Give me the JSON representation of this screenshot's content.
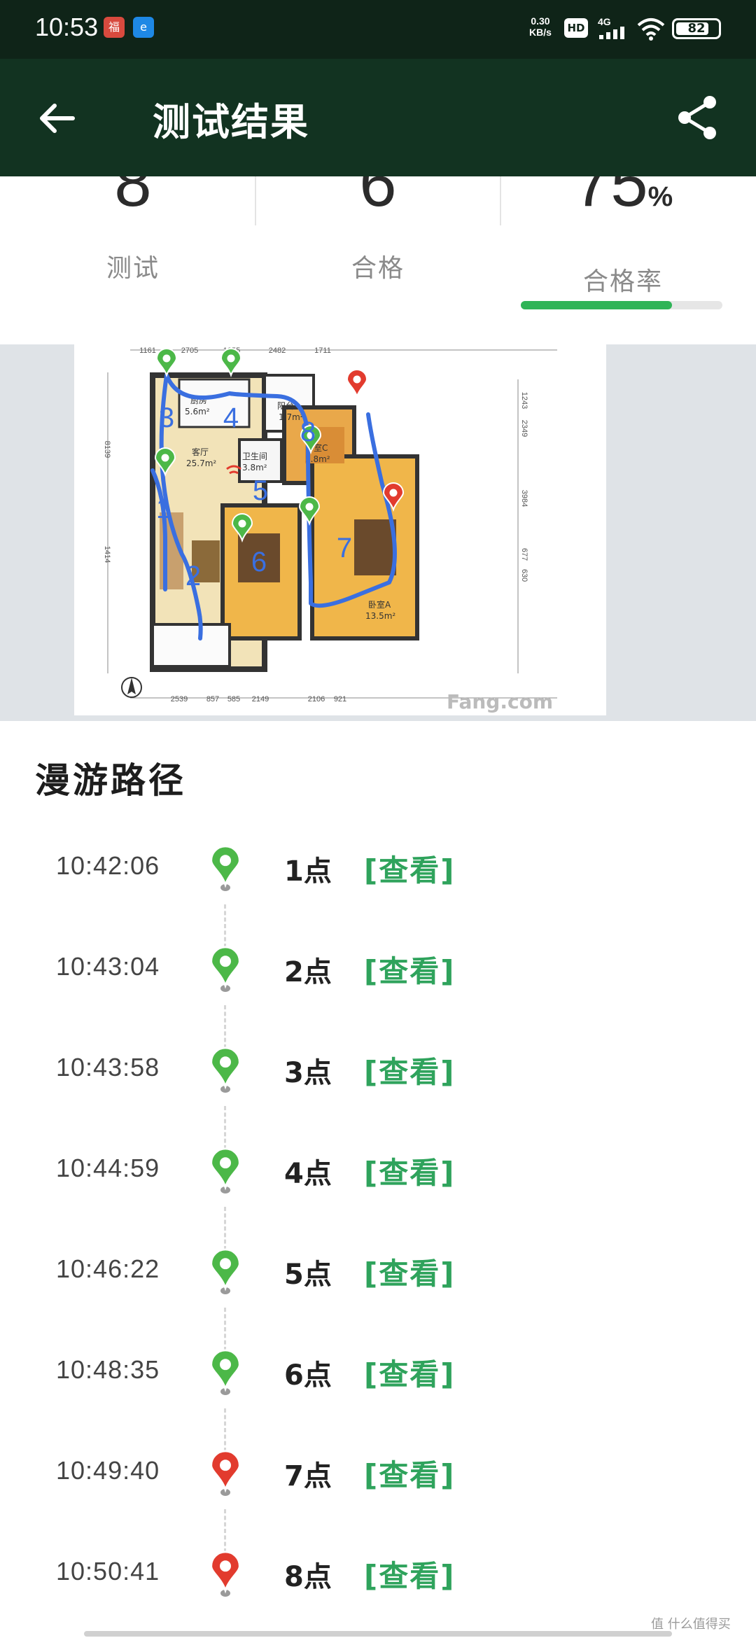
{
  "status_bar": {
    "time": "10:53",
    "net_speed_value": "0.30",
    "net_speed_unit": "KB/s",
    "hd_label": "HD",
    "network_label": "4G",
    "battery": "82",
    "battery_level": 0.82
  },
  "app_bar": {
    "title": "测试结果",
    "back_icon": "arrow-left-icon",
    "share_icon": "share-icon"
  },
  "summary": {
    "tests": {
      "value": "8",
      "label": "测试"
    },
    "passed": {
      "value": "6",
      "label": "合格"
    },
    "pass_rate": {
      "value": "75",
      "unit": "%",
      "label": "合格率",
      "fraction": 0.75
    }
  },
  "floor_plan": {
    "top_dims": [
      "1161",
      "2705",
      "1055",
      "2482",
      "1711"
    ],
    "bottom_dims": [
      "2539",
      "857",
      "585",
      "2149",
      "2106",
      "921"
    ],
    "left_dims": [
      "8139",
      "1414"
    ],
    "right_dims": [
      "1243",
      "2349",
      "3984",
      "677",
      "630"
    ],
    "rooms": [
      {
        "name": "厨房",
        "area": "5.6m²"
      },
      {
        "name": "阳台B",
        "area": "1.7m²"
      },
      {
        "name": "卧室C",
        "area": "5.8m²"
      },
      {
        "name": "客厅",
        "area": "25.7m²"
      },
      {
        "name": "卫生间",
        "area": "3.8m²"
      },
      {
        "name": "卧室A",
        "area": "13.5m²"
      }
    ],
    "watermark": "Fang.com",
    "route_numbers": [
      "1",
      "2",
      "3",
      "4",
      "5",
      "6",
      "7",
      "8"
    ],
    "pass_color": "#4cb848",
    "fail_color": "#e23b2e",
    "route_color": "#3a6fe0"
  },
  "route": {
    "title": "漫游路径",
    "view_label": "[查看]",
    "items": [
      {
        "time": "10:42:06",
        "name": "1点",
        "status": "pass"
      },
      {
        "time": "10:43:04",
        "name": "2点",
        "status": "pass"
      },
      {
        "time": "10:43:58",
        "name": "3点",
        "status": "pass"
      },
      {
        "time": "10:44:59",
        "name": "4点",
        "status": "pass"
      },
      {
        "time": "10:46:22",
        "name": "5点",
        "status": "pass"
      },
      {
        "time": "10:48:35",
        "name": "6点",
        "status": "pass"
      },
      {
        "time": "10:49:40",
        "name": "7点",
        "status": "fail"
      },
      {
        "time": "10:50:41",
        "name": "8点",
        "status": "fail"
      }
    ]
  },
  "footer": {
    "watermark": "值 什么值得买"
  }
}
